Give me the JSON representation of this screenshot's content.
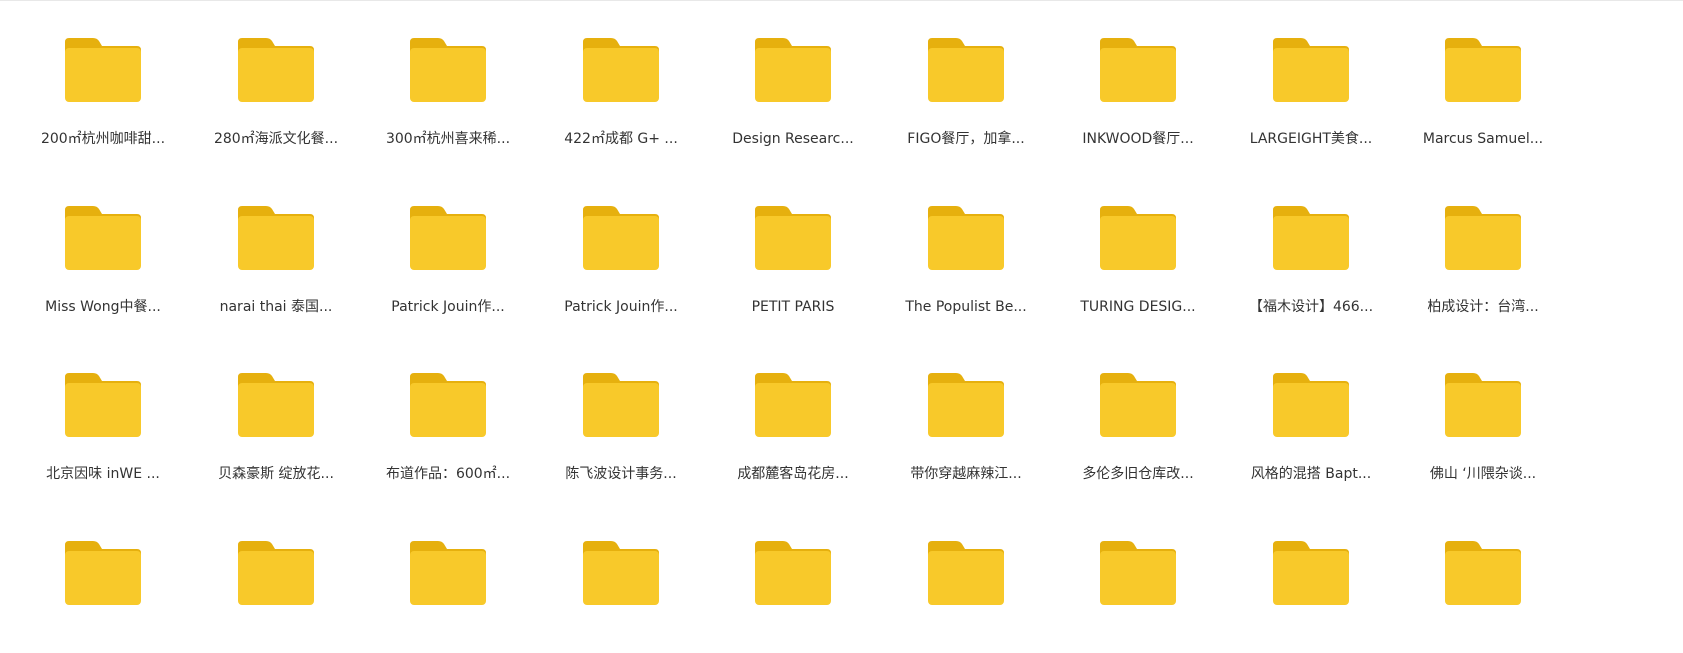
{
  "folder_color": "#F8C92A",
  "folder_tab_color": "#E6B00E",
  "label_color": "#333333",
  "folders": [
    {
      "label": "200㎡杭州咖啡甜..."
    },
    {
      "label": "280㎡海派文化餐..."
    },
    {
      "label": "300㎡杭州喜来稀..."
    },
    {
      "label": "422㎡成都 G+ ..."
    },
    {
      "label": "Design Researc..."
    },
    {
      "label": "FIGO餐厅，加拿..."
    },
    {
      "label": "INKWOOD餐厅..."
    },
    {
      "label": "LARGEIGHT美食..."
    },
    {
      "label": "Marcus Samuel..."
    },
    {
      "label": "Miss Wong中餐..."
    },
    {
      "label": "narai thai 泰国..."
    },
    {
      "label": "Patrick Jouin作..."
    },
    {
      "label": "Patrick Jouin作..."
    },
    {
      "label": "PETIT PARIS"
    },
    {
      "label": "The Populist Be..."
    },
    {
      "label": "TURING DESIG..."
    },
    {
      "label": "【福木设计】466..."
    },
    {
      "label": "柏成设计：台湾..."
    },
    {
      "label": "北京因味 inWE ..."
    },
    {
      "label": "贝森豪斯  绽放花..."
    },
    {
      "label": "布道作品：600㎡..."
    },
    {
      "label": "陈飞波设计事务..."
    },
    {
      "label": "成都麓客岛花房..."
    },
    {
      "label": "带你穿越麻辣江..."
    },
    {
      "label": "多伦多旧仓库改..."
    },
    {
      "label": "风格的混搭 Bapt..."
    },
    {
      "label": "佛山 ‘川隈杂谈..."
    },
    {
      "label": ""
    },
    {
      "label": ""
    },
    {
      "label": ""
    },
    {
      "label": ""
    },
    {
      "label": ""
    },
    {
      "label": ""
    },
    {
      "label": ""
    },
    {
      "label": ""
    },
    {
      "label": ""
    }
  ]
}
